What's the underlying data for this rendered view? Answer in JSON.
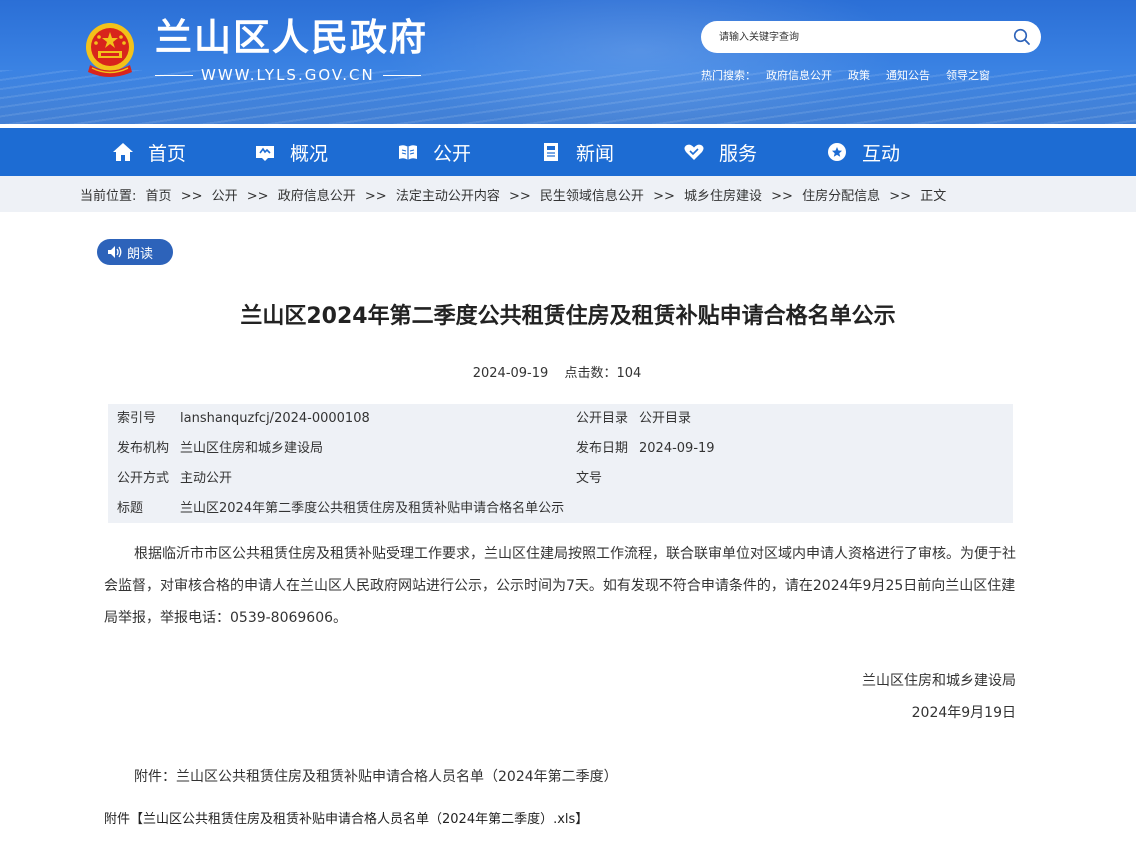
{
  "header": {
    "site_title": "兰山区人民政府",
    "site_url": "WWW.LYLS.GOV.CN",
    "search": {
      "placeholder": "请输入关键字查询"
    },
    "hot_search": {
      "label": "热门搜索：",
      "items": [
        "政府信息公开",
        "政策",
        "通知公告",
        "领导之窗"
      ]
    }
  },
  "nav": {
    "items": [
      {
        "label": "首页",
        "icon": "home-icon"
      },
      {
        "label": "概况",
        "icon": "overview-icon"
      },
      {
        "label": "公开",
        "icon": "book-icon"
      },
      {
        "label": "新闻",
        "icon": "news-icon"
      },
      {
        "label": "服务",
        "icon": "heart-icon"
      },
      {
        "label": "互动",
        "icon": "interaction-icon"
      }
    ]
  },
  "breadcrumb": {
    "label": "当前位置:",
    "items": [
      "首页",
      "公开",
      "政府信息公开",
      "法定主动公开内容",
      "民生领域信息公开",
      "城乡住房建设",
      "住房分配信息",
      "正文"
    ],
    "separator": ">>"
  },
  "read_button": {
    "label": "朗读"
  },
  "article": {
    "title": "兰山区2024年第二季度公共租赁住房及租赁补贴申请合格名单公示",
    "date": "2024-09-19",
    "views": "点击数：104"
  },
  "info_table": {
    "index_label": "索引号",
    "index_value": "lanshanquzfcj/2024-0000108",
    "catalog_label": "公开目录",
    "catalog_value": "公开目录",
    "publisher_label": "发布机构",
    "publisher_value": "兰山区住房和城乡建设局",
    "publish_date_label": "发布日期",
    "publish_date_value": "2024-09-19",
    "method_label": "公开方式",
    "method_value": "主动公开",
    "doc_no_label": "文号",
    "subject_label": "标题",
    "subject_value": "兰山区2024年第二季度公共租赁住房及租赁补贴申请合格名单公示"
  },
  "body": {
    "paragraph": "根据临沂市市区公共租赁住房及租赁补贴受理工作要求，兰山区住建局按照工作流程，联合联审单位对区域内申请人资格进行了审核。为便于社会监督，对审核合格的申请人在兰山区人民政府网站进行公示，公示时间为7天。如有发现不符合申请条件的，请在2024年9月25日前向兰山区住建局举报，举报电话：0539-8069606。",
    "sign_org": "兰山区住房和城乡建设局",
    "sign_date": "2024年9月19日",
    "attachment_text": "附件：兰山区公共租赁住房及租赁补贴申请合格人员名单（2024年第二季度）",
    "attachment_link": "附件【兰山区公共租赁住房及租赁补贴申请合格人员名单（2024年第二季度）.xls】"
  },
  "colors": {
    "header_blue": "#2b6fd6",
    "nav_blue": "#1d6cd3",
    "breadcrumb_bg": "#eef1f6",
    "read_button_bg": "#2d63ba",
    "emblem_red": "#d8241c",
    "emblem_gold": "#f3c21a"
  }
}
